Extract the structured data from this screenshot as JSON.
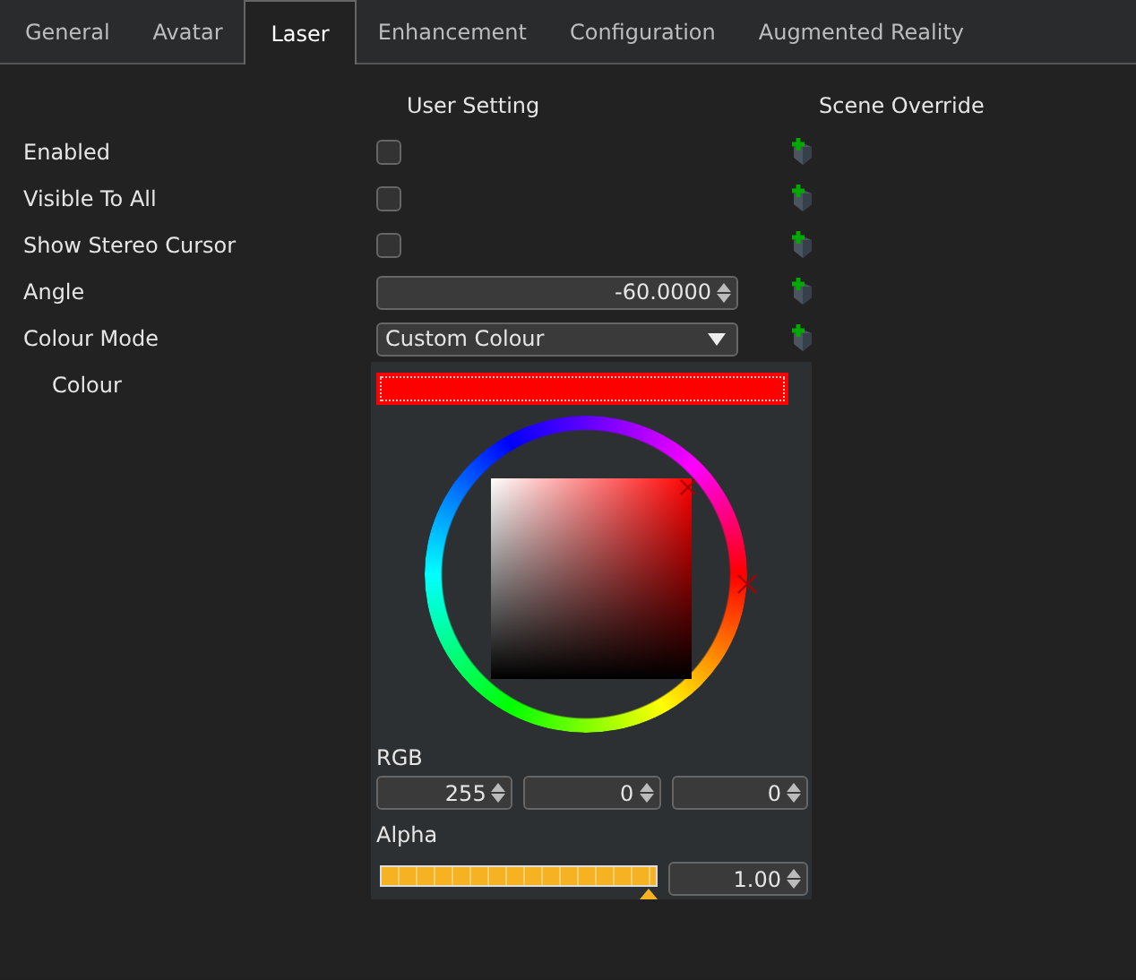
{
  "tabs": [
    {
      "label": "General",
      "selected": false
    },
    {
      "label": "Avatar",
      "selected": false
    },
    {
      "label": "Laser",
      "selected": true
    },
    {
      "label": "Enhancement",
      "selected": false
    },
    {
      "label": "Configuration",
      "selected": false
    },
    {
      "label": "Augmented Reality",
      "selected": false
    }
  ],
  "columns": {
    "user": "User Setting",
    "override": "Scene Override"
  },
  "rows": [
    {
      "label": "Enabled",
      "kind": "checkbox",
      "checked": false,
      "override": true
    },
    {
      "label": "Visible To All",
      "kind": "checkbox",
      "checked": false,
      "override": true
    },
    {
      "label": "Show Stereo Cursor",
      "kind": "checkbox",
      "checked": false,
      "override": true
    },
    {
      "label": "Angle",
      "kind": "spin",
      "value": "-60.0000",
      "override": true
    },
    {
      "label": "Colour Mode",
      "kind": "combo",
      "value": "Custom Colour",
      "override": true
    },
    {
      "label": "Colour",
      "kind": "color",
      "color": "#ff0000",
      "override": false
    }
  ],
  "picker": {
    "rgb_label": "RGB",
    "rgb": [
      "255",
      "0",
      "0"
    ],
    "alpha_label": "Alpha",
    "alpha": {
      "level": 1,
      "value": "1.00"
    }
  }
}
